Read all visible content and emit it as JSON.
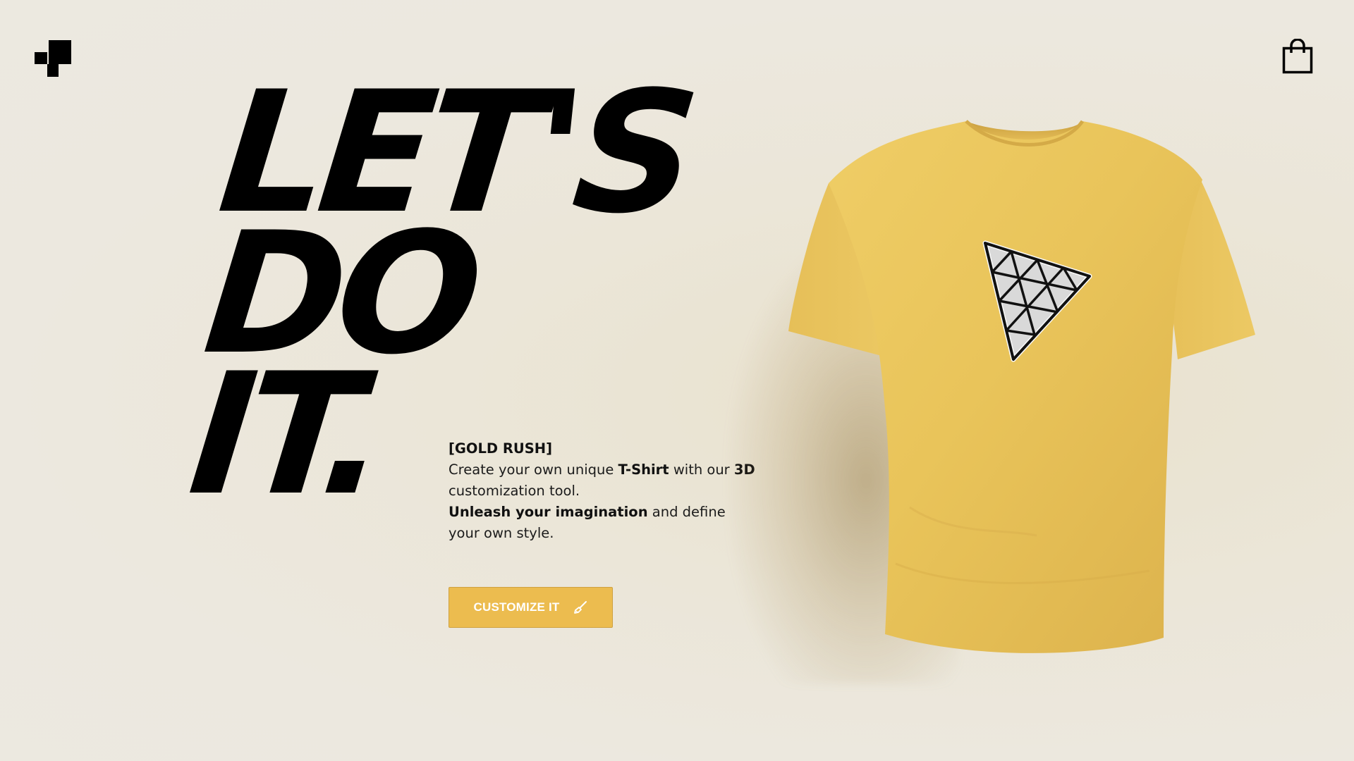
{
  "header": {
    "logo_icon": "blocks-logo-icon",
    "cart_icon": "shopping-bag-icon"
  },
  "hero": {
    "headline_line1": "LET'S",
    "headline_line2": "DO",
    "headline_line3": "IT.",
    "tagline": "[GOLD RUSH]",
    "description": {
      "part1": "Create your own unique ",
      "bold1": "T-Shirt",
      "part2": " with our ",
      "bold2": "3D",
      "part3": " customization tool.",
      "bold3": "Unleash your imagination",
      "part4": " and define your own style."
    },
    "cta_label": "CUSTOMIZE IT",
    "cta_icon": "brush-icon"
  },
  "product": {
    "name": "t-shirt",
    "color": "#e8c157",
    "decal_icon": "triangle-grid-decal"
  },
  "colors": {
    "accent": "#ecbc4f",
    "background": "#ece8df",
    "text": "#111111"
  }
}
